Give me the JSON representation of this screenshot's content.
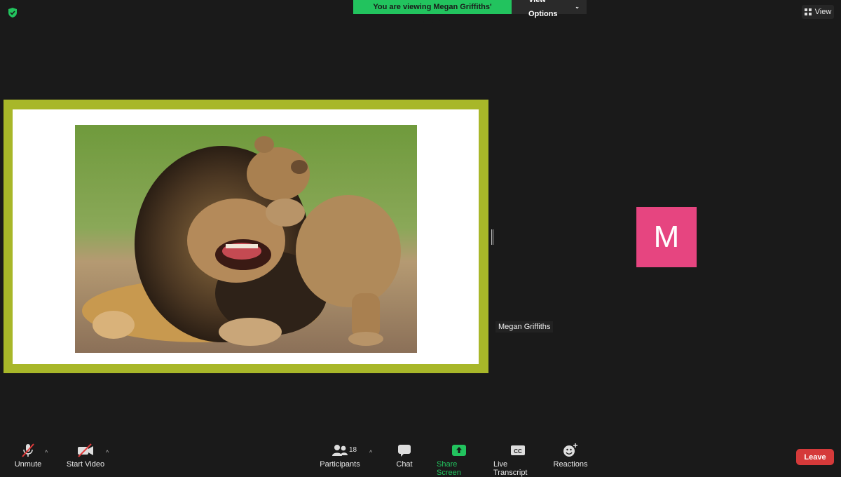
{
  "banner": {
    "viewing_text": "You are viewing Megan Griffiths' screen",
    "view_options": "View Options"
  },
  "top_right": {
    "view_label": "View"
  },
  "participant": {
    "name": "Megan Griffiths",
    "initial": "M",
    "avatar_color": "#e64580"
  },
  "shared_content": {
    "frame_color": "#a8b729",
    "image_description": "lion-cub-playing-with-adult-lion"
  },
  "toolbar": {
    "unmute": "Unmute",
    "start_video": "Start Video",
    "participants": "Participants",
    "participants_count": "18",
    "chat": "Chat",
    "share_screen": "Share Screen",
    "live_transcript": "Live Transcript",
    "reactions": "Reactions",
    "leave": "Leave"
  },
  "colors": {
    "background": "#1a1a1a",
    "share_green": "#22c35e",
    "leave_red": "#d53a3a"
  },
  "icons": [
    "shield-icon",
    "grid-icon",
    "mic-muted-icon",
    "video-off-icon",
    "participants-icon",
    "chat-icon",
    "share-screen-icon",
    "cc-icon",
    "reactions-icon"
  ]
}
